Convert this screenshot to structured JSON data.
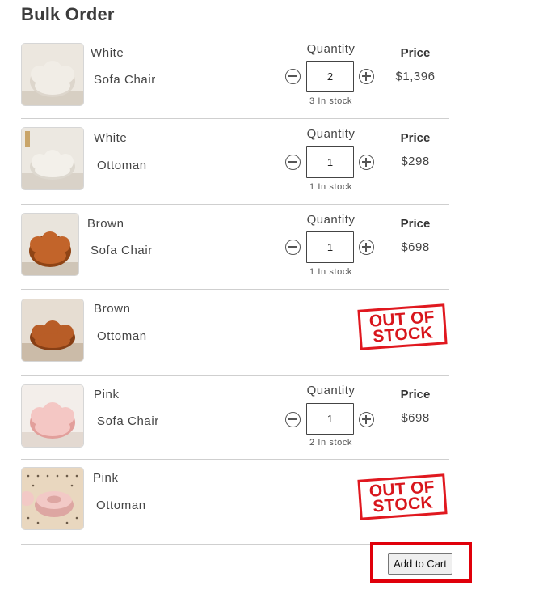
{
  "page": {
    "title": "Bulk Order"
  },
  "labels": {
    "quantity": "Quantity",
    "price": "Price"
  },
  "products": [
    {
      "color": "White",
      "name": "Sofa Chair",
      "quantity": "2",
      "stock": "3 In stock",
      "price": "$1,396",
      "available": true,
      "tone": "#f1ede6",
      "shade": "#ddd6cc"
    },
    {
      "color": "White",
      "name": "Ottoman",
      "quantity": "1",
      "stock": "1 In stock",
      "price": "$298",
      "available": true,
      "tone": "#f3f0ea",
      "shade": "#ddd8cf"
    },
    {
      "color": "Brown",
      "name": "Sofa Chair",
      "quantity": "1",
      "stock": "1 In stock",
      "price": "$698",
      "available": true,
      "tone": "#c2642a",
      "shade": "#8f4415"
    },
    {
      "color": "Brown",
      "name": "Ottoman",
      "stock": "",
      "available": false,
      "tone": "#b85d27",
      "shade": "#873f15",
      "badge_lines": [
        "OUT OF",
        "STOCK"
      ]
    },
    {
      "color": "Pink",
      "name": "Sofa Chair",
      "quantity": "1",
      "stock": "2 In stock",
      "price": "$698",
      "available": true,
      "tone": "#f4c7c4",
      "shade": "#e29f9b"
    },
    {
      "color": "Pink",
      "name": "Ottoman",
      "stock": "",
      "available": false,
      "tone": "#f2c9c6",
      "shade": "#dda6a2",
      "badge_lines": [
        "OUT OF",
        "STOCK"
      ]
    }
  ],
  "actions": {
    "add_to_cart": "Add to Cart"
  },
  "colors": {
    "highlight": "#e0000a",
    "out_of_stock": "#d8161d"
  }
}
